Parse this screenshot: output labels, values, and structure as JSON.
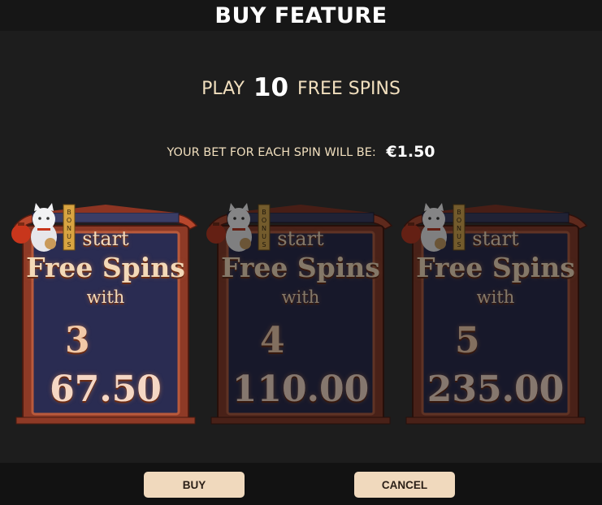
{
  "header": {
    "title": "BUY FEATURE"
  },
  "play": {
    "prefix": "PLAY",
    "count": "10",
    "suffix": "FREE SPINS"
  },
  "bet": {
    "label": "YOUR BET FOR EACH SPIN WILL BE:",
    "amount": "€1.50"
  },
  "cards": [
    {
      "line1": "start",
      "line2": "Free Spins",
      "line3": "with",
      "count": "3",
      "bonus": "BONUS",
      "price": "67.50",
      "selected": true
    },
    {
      "line1": "start",
      "line2": "Free Spins",
      "line3": "with",
      "count": "4",
      "bonus": "BONUS",
      "price": "110.00",
      "selected": false
    },
    {
      "line1": "start",
      "line2": "Free Spins",
      "line3": "with",
      "count": "5",
      "bonus": "BONUS",
      "price": "235.00",
      "selected": false
    }
  ],
  "buttons": {
    "buy": "BUY",
    "cancel": "CANCEL"
  },
  "colors": {
    "frame": "#a8412a",
    "panel": "#2a2c52",
    "accent": "#f0d9bd",
    "text_cream": "#f1dfbe"
  }
}
